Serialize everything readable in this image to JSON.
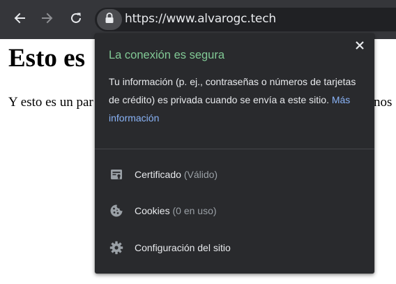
{
  "toolbar": {
    "url": "https://www.alvarogc.tech"
  },
  "page": {
    "heading": "Esto es",
    "paragraph": "Y esto es un par",
    "paragraph_tail": "nos"
  },
  "popup": {
    "title": "La conexión es segura",
    "description": "Tu información (p. ej., contraseñas o números de tarjetas de crédito) es privada cuando se envía a este sitio.",
    "more_info_link": "Más información",
    "rows": [
      {
        "label": "Certificado",
        "detail": "(Válido)",
        "icon": "certificate-icon"
      },
      {
        "label": "Cookies",
        "detail": "(0 en uso)",
        "icon": "cookie-icon"
      },
      {
        "label": "Configuración del sitio",
        "detail": "",
        "icon": "gear-icon"
      }
    ]
  },
  "colors": {
    "toolbar_bg": "#35363a",
    "popup_bg": "#292a2d",
    "secure_green": "#81c995",
    "link_blue": "#8ab4f8",
    "muted_text": "#9aa0a6"
  }
}
